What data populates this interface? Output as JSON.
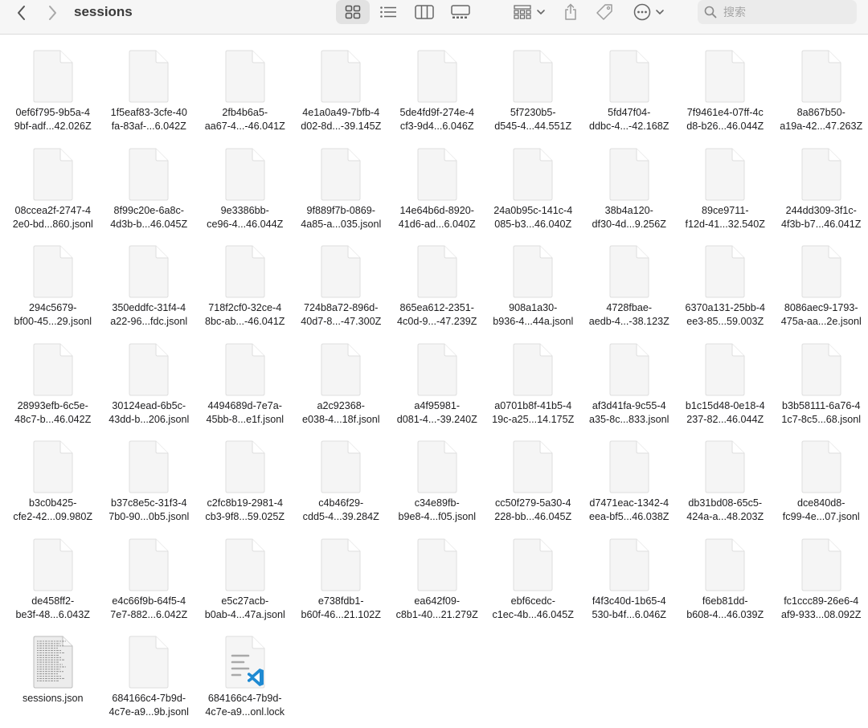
{
  "window": {
    "folder_title": "sessions",
    "search_placeholder": "搜索"
  },
  "toolbar": {
    "icons": [
      "chevron-left-icon",
      "chevron-right-icon",
      "icon-view-icon",
      "list-view-icon",
      "column-view-icon",
      "gallery-view-icon",
      "group-icon",
      "share-icon",
      "tag-icon",
      "more-icon",
      "search-icon"
    ],
    "active_view": "icon-view"
  },
  "files": [
    {
      "label": "0ef6f795-9b5a-4\n9bf-adf...42.026Z",
      "type": "blank"
    },
    {
      "label": "1f5eaf83-3cfe-40\nfa-83af-...6.042Z",
      "type": "blank"
    },
    {
      "label": "2fb4b6a5-\naa67-4...-46.041Z",
      "type": "blank"
    },
    {
      "label": "4e1a0a49-7bfb-4\nd02-8d...-39.145Z",
      "type": "blank"
    },
    {
      "label": "5de4fd9f-274e-4\ncf3-9d4...6.046Z",
      "type": "blank"
    },
    {
      "label": "5f7230b5-\nd545-4...44.551Z",
      "type": "blank"
    },
    {
      "label": "5fd47f04-\nddbc-4...-42.168Z",
      "type": "blank"
    },
    {
      "label": "7f9461e4-07ff-4c\nd8-b26...46.044Z",
      "type": "blank"
    },
    {
      "label": "8a867b50-\na19a-42...47.263Z",
      "type": "blank"
    },
    {
      "label": "08ccea2f-2747-4\n2e0-bd...860.jsonl",
      "type": "blank"
    },
    {
      "label": "8f99c20e-6a8c-\n4d3b-b...46.045Z",
      "type": "blank"
    },
    {
      "label": "9e3386bb-\nce96-4...46.044Z",
      "type": "blank"
    },
    {
      "label": "9f889f7b-0869-\n4a85-a...035.jsonl",
      "type": "blank"
    },
    {
      "label": "14e64b6d-8920-\n41d6-ad...6.040Z",
      "type": "blank"
    },
    {
      "label": "24a0b95c-141c-4\n085-b3...46.040Z",
      "type": "blank"
    },
    {
      "label": "38b4a120-\ndf30-4d...9.256Z",
      "type": "blank"
    },
    {
      "label": "89ce9711-\nf12d-41...32.540Z",
      "type": "blank"
    },
    {
      "label": "244dd309-3f1c-\n4f3b-b7...46.041Z",
      "type": "blank"
    },
    {
      "label": "294c5679-\nbf00-45...29.jsonl",
      "type": "blank"
    },
    {
      "label": "350eddfc-31f4-4\na22-96...fdc.jsonl",
      "type": "blank"
    },
    {
      "label": "718f2cf0-32ce-4\n8bc-ab...-46.041Z",
      "type": "blank"
    },
    {
      "label": "724b8a72-896d-\n40d7-8...-47.300Z",
      "type": "blank"
    },
    {
      "label": "865ea612-2351-\n4c0d-9...-47.239Z",
      "type": "blank"
    },
    {
      "label": "908a1a30-\nb936-4...44a.jsonl",
      "type": "blank"
    },
    {
      "label": "4728fbae-\naedb-4...-38.123Z",
      "type": "blank"
    },
    {
      "label": "6370a131-25bb-4\nee3-85...59.003Z",
      "type": "blank"
    },
    {
      "label": "8086aec9-1793-\n475a-aa...2e.jsonl",
      "type": "blank"
    },
    {
      "label": "28993efb-6c5e-\n48c7-b...46.042Z",
      "type": "blank"
    },
    {
      "label": "30124ead-6b5c-\n43dd-b...206.jsonl",
      "type": "blank"
    },
    {
      "label": "4494689d-7e7a-\n45bb-8...e1f.jsonl",
      "type": "blank"
    },
    {
      "label": "a2c92368-\ne038-4...18f.jsonl",
      "type": "blank"
    },
    {
      "label": "a4f95981-\nd081-4...-39.240Z",
      "type": "blank"
    },
    {
      "label": "a0701b8f-41b5-4\n19c-a25...14.175Z",
      "type": "blank"
    },
    {
      "label": "af3d41fa-9c55-4\na35-8c...833.jsonl",
      "type": "blank"
    },
    {
      "label": "b1c15d48-0e18-4\n237-82...46.044Z",
      "type": "blank"
    },
    {
      "label": "b3b58111-6a76-4\n1c7-8c5...68.jsonl",
      "type": "blank"
    },
    {
      "label": "b3c0b425-\ncfe2-42...09.980Z",
      "type": "blank"
    },
    {
      "label": "b37c8e5c-31f3-4\n7b0-90...0b5.jsonl",
      "type": "blank"
    },
    {
      "label": "c2fc8b19-2981-4\ncb3-9f8...59.025Z",
      "type": "blank"
    },
    {
      "label": "c4b46f29-\ncdd5-4...39.284Z",
      "type": "blank"
    },
    {
      "label": "c34e89fb-\nb9e8-4...f05.jsonl",
      "type": "blank"
    },
    {
      "label": "cc50f279-5a30-4\n228-bb...46.045Z",
      "type": "blank"
    },
    {
      "label": "d7471eac-1342-4\neea-bf5...46.038Z",
      "type": "blank"
    },
    {
      "label": "db31bd08-65c5-\n424a-a...48.203Z",
      "type": "blank"
    },
    {
      "label": "dce840d8-\nfc99-4e...07.jsonl",
      "type": "blank"
    },
    {
      "label": "de458ff2-\nbe3f-48...6.043Z",
      "type": "blank"
    },
    {
      "label": "e4c66f9b-64f5-4\n7e7-882...6.042Z",
      "type": "blank"
    },
    {
      "label": "e5c27acb-\nb0ab-4...47a.jsonl",
      "type": "blank"
    },
    {
      "label": "e738fdb1-\nb60f-46...21.102Z",
      "type": "blank"
    },
    {
      "label": "ea642f09-\nc8b1-40...21.279Z",
      "type": "blank"
    },
    {
      "label": "ebf6cedc-\nc1ec-4b...46.045Z",
      "type": "blank"
    },
    {
      "label": "f4f3c40d-1b65-4\n530-b4f...6.046Z",
      "type": "blank"
    },
    {
      "label": "f6eb81dd-\nb608-4...46.039Z",
      "type": "blank"
    },
    {
      "label": "fc1ccc89-26e6-4\naf9-933...08.092Z",
      "type": "blank"
    },
    {
      "label": "sessions.json",
      "type": "json"
    },
    {
      "label": "684166c4-7b9d-\n4c7e-a9...9b.jsonl",
      "type": "blank"
    },
    {
      "label": "684166c4-7b9d-\n4c7e-a9...onl.lock",
      "type": "vscode"
    }
  ]
}
